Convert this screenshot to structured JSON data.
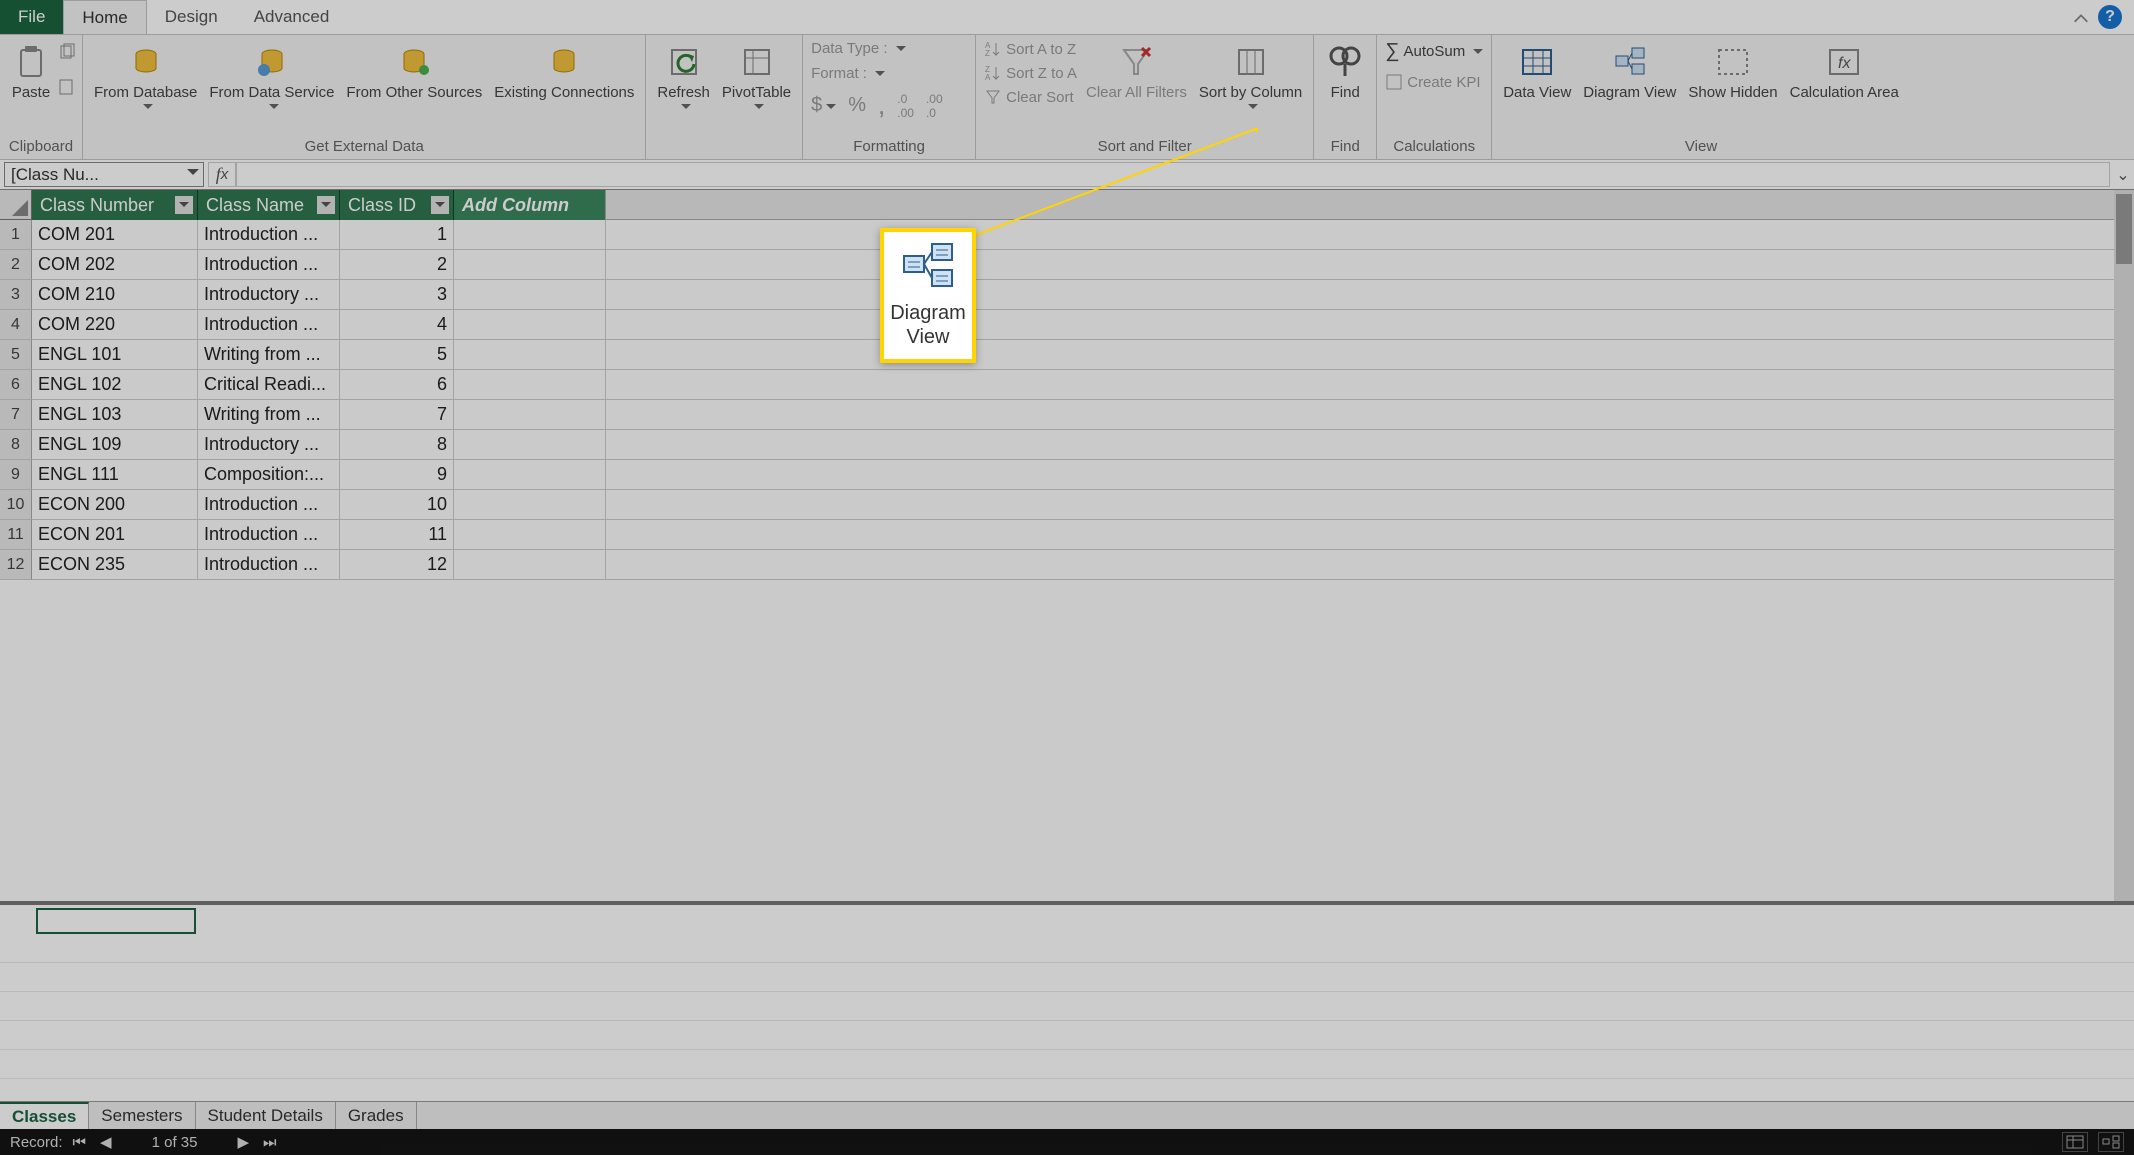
{
  "tabs": {
    "file": "File",
    "home": "Home",
    "design": "Design",
    "advanced": "Advanced"
  },
  "ribbon": {
    "clipboard": {
      "paste": "Paste",
      "label": "Clipboard"
    },
    "getdata": {
      "from_db": "From\nDatabase",
      "from_svc": "From Data\nService",
      "from_other": "From Other\nSources",
      "existing": "Existing\nConnections",
      "label": "Get External Data"
    },
    "refresh": "Refresh",
    "pivot": "PivotTable",
    "formatting": {
      "datatype": "Data Type :",
      "format": "Format :",
      "currency": "$",
      "percent": "%",
      "comma": ",",
      "inc_dec": ".00→.0",
      "dec_inc": ".0→.00",
      "label": "Formatting"
    },
    "sortfilter": {
      "az": "Sort A to Z",
      "za": "Sort Z to A",
      "clear": "Clear Sort",
      "clearall": "Clear All\nFilters",
      "sortby": "Sort by\nColumn",
      "label": "Sort and Filter"
    },
    "find": {
      "btn": "Find",
      "label": "Find"
    },
    "calc": {
      "autosum": "AutoSum",
      "kpi": "Create KPI",
      "label": "Calculations"
    },
    "view": {
      "data": "Data\nView",
      "diagram": "Diagram\nView",
      "hidden": "Show\nHidden",
      "calcarea": "Calculation\nArea",
      "label": "View"
    }
  },
  "namebox": "[Class Nu...",
  "columns": {
    "c1": "Class Number",
    "c2": "Class Name",
    "c3": "Class ID",
    "add": "Add Column"
  },
  "rows": [
    {
      "n": "1",
      "num": "COM 201",
      "name": "Introduction ...",
      "id": "1"
    },
    {
      "n": "2",
      "num": "COM 202",
      "name": "Introduction ...",
      "id": "2"
    },
    {
      "n": "3",
      "num": "COM 210",
      "name": "Introductory ...",
      "id": "3"
    },
    {
      "n": "4",
      "num": "COM 220",
      "name": "Introduction ...",
      "id": "4"
    },
    {
      "n": "5",
      "num": "ENGL 101",
      "name": "Writing from ...",
      "id": "5"
    },
    {
      "n": "6",
      "num": "ENGL 102",
      "name": "Critical Readi...",
      "id": "6"
    },
    {
      "n": "7",
      "num": "ENGL 103",
      "name": "Writing from ...",
      "id": "7"
    },
    {
      "n": "8",
      "num": "ENGL 109",
      "name": "Introductory ...",
      "id": "8"
    },
    {
      "n": "9",
      "num": "ENGL 111",
      "name": "Composition:...",
      "id": "9"
    },
    {
      "n": "10",
      "num": "ECON 200",
      "name": "Introduction ...",
      "id": "10"
    },
    {
      "n": "11",
      "num": "ECON 201",
      "name": "Introduction ...",
      "id": "11"
    },
    {
      "n": "12",
      "num": "ECON 235",
      "name": "Introduction ...",
      "id": "12"
    }
  ],
  "sheet_tabs": {
    "t1": "Classes",
    "t2": "Semesters",
    "t3": "Student Details",
    "t4": "Grades"
  },
  "status": {
    "record": "Record:",
    "pos": "1 of 35"
  },
  "callout": "Diagram\nView",
  "col_widths": {
    "c1": 166,
    "c2": 142,
    "c3": 114,
    "add": 152
  }
}
